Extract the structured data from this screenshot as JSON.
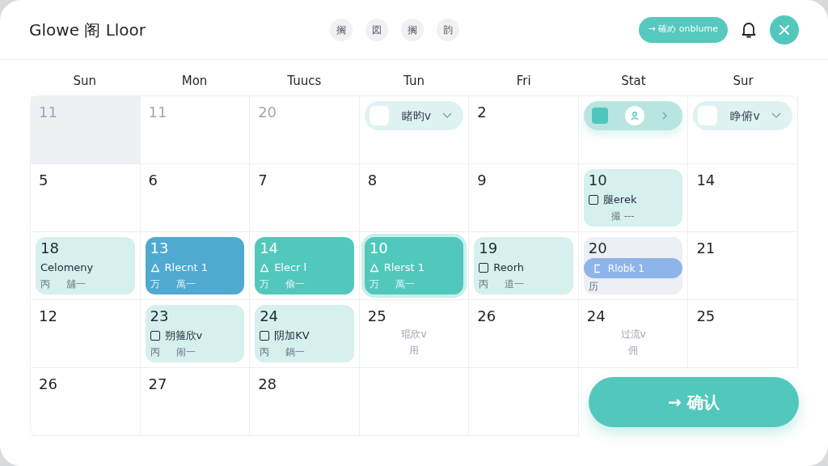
{
  "header": {
    "title": "Glowe 阁 Lloor",
    "chips": [
      "搁",
      "図",
      "搁",
      "韵"
    ],
    "action_button": {
      "label": "→ 確め onblume"
    }
  },
  "weekdays": [
    "Sun",
    "Mon",
    "Tuucs",
    "Tun",
    "Fri",
    "Stat",
    "Sur"
  ],
  "cells": [
    {
      "kind": "muted",
      "day": "11",
      "shaded": true
    },
    {
      "kind": "muted",
      "day": "11",
      "shaded": false
    },
    {
      "kind": "muted",
      "day": "20",
      "shaded": false
    },
    {
      "kind": "dropdown",
      "label": "睹昀v"
    },
    {
      "kind": "plain",
      "day": "2"
    },
    {
      "kind": "picker"
    },
    {
      "kind": "dropdown",
      "label": "睁俯v"
    },
    {
      "kind": "plain",
      "day": "5"
    },
    {
      "kind": "plain",
      "day": "6"
    },
    {
      "kind": "plain",
      "day": "7"
    },
    {
      "kind": "plain",
      "day": "8"
    },
    {
      "kind": "plain",
      "day": "9"
    },
    {
      "kind": "event",
      "day": "10",
      "color": "#d6f0ee",
      "title": "腿erek",
      "sub_b": "撮 ---"
    },
    {
      "kind": "plain",
      "day": "14"
    },
    {
      "kind": "memo",
      "day": "18",
      "color": "#d6f0ee",
      "title": "Celomeny",
      "sub_a": "丙",
      "sub_b": "舖一"
    },
    {
      "kind": "event",
      "day": "13",
      "color": "#4fa9d1",
      "title": "Rlecnt 1",
      "sub_a": "万",
      "sub_b": "萬一"
    },
    {
      "kind": "event",
      "day": "14",
      "color": "#52c8bd",
      "title": "Elecr l",
      "sub_a": "万",
      "sub_b": "偷一"
    },
    {
      "kind": "focus",
      "day": "10",
      "color": "#52c8bd",
      "title": "Rlerst 1",
      "sub_a": "万",
      "sub_b": "萬一"
    },
    {
      "kind": "event",
      "day": "19",
      "color": "#d6f0ee",
      "title": "Reorh",
      "sub_a": "丙",
      "sub_b": "道一"
    },
    {
      "kind": "split",
      "day": "20",
      "color": "#eceff4",
      "title": "Rlobk 1",
      "sub_a": "历"
    },
    {
      "kind": "plain",
      "day": "21"
    },
    {
      "kind": "plain",
      "day": "12"
    },
    {
      "kind": "event",
      "day": "23",
      "color": "#d6f0ee",
      "title": "朔箍欣v",
      "sub_a": "丙",
      "sub_b": "闹一"
    },
    {
      "kind": "event",
      "day": "24",
      "color": "#d6f0ee",
      "title": "阴加KV",
      "sub_a": "丙",
      "sub_b": "鍋一"
    },
    {
      "kind": "note",
      "day": "25",
      "lines": [
        "琨欣v",
        "用"
      ]
    },
    {
      "kind": "plain",
      "day": "26"
    },
    {
      "kind": "note",
      "day": "24",
      "lines": [
        "过流v",
        "佣"
      ]
    },
    {
      "kind": "plain",
      "day": "25"
    },
    {
      "kind": "plain",
      "day": "26"
    },
    {
      "kind": "plain",
      "day": "27"
    },
    {
      "kind": "plain",
      "day": "28"
    },
    {
      "kind": "empty"
    },
    {
      "kind": "empty"
    }
  ],
  "confirm_button": {
    "label": "→ 确认"
  }
}
